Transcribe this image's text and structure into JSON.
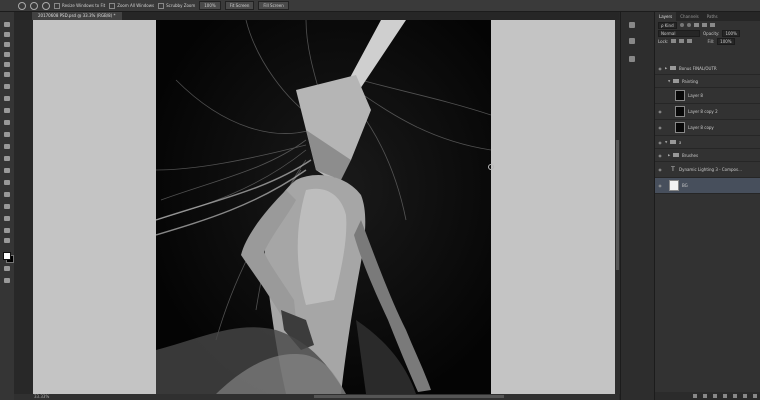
{
  "options_bar": {
    "btn1": "Resize Windows to Fit",
    "btn2": "Zoom All Windows",
    "check1": "Scrubby Zoom",
    "btn3": "100%",
    "btn4": "Fit Screen",
    "btn5": "Fill Screen"
  },
  "document": {
    "tab_title": "20170608 PSD.psd @ 33.3% (RGB/8) *"
  },
  "status": {
    "zoom": "33.33%"
  },
  "panel": {
    "tabs": [
      "Layers",
      "Channels",
      "Paths"
    ],
    "kind_label": "ρ Kind",
    "blend_mode": "Normal",
    "opacity_label": "Opacity:",
    "opacity_value": "100%",
    "lock_label": "Lock:",
    "fill_label": "Fill:",
    "fill_value": "100%",
    "layers": [
      {
        "name": "Bonus FINAL/OUTR",
        "type": "folder"
      },
      {
        "name": "Painting",
        "type": "folder"
      },
      {
        "name": "Layer 8",
        "type": "layer"
      },
      {
        "name": "Layer 8 copy 2",
        "type": "layer"
      },
      {
        "name": "Layer 8 copy",
        "type": "layer"
      },
      {
        "name": "a",
        "type": "folder"
      },
      {
        "name": "Brushes",
        "type": "folder"
      },
      {
        "name": "Dynamic Lighting 3 - Compos...",
        "type": "text"
      },
      {
        "name": "BG",
        "type": "layer"
      }
    ]
  },
  "colors": {
    "ui_dark": "#282828",
    "pasteboard": "#c4c4c4",
    "selection": "#474f5c"
  }
}
